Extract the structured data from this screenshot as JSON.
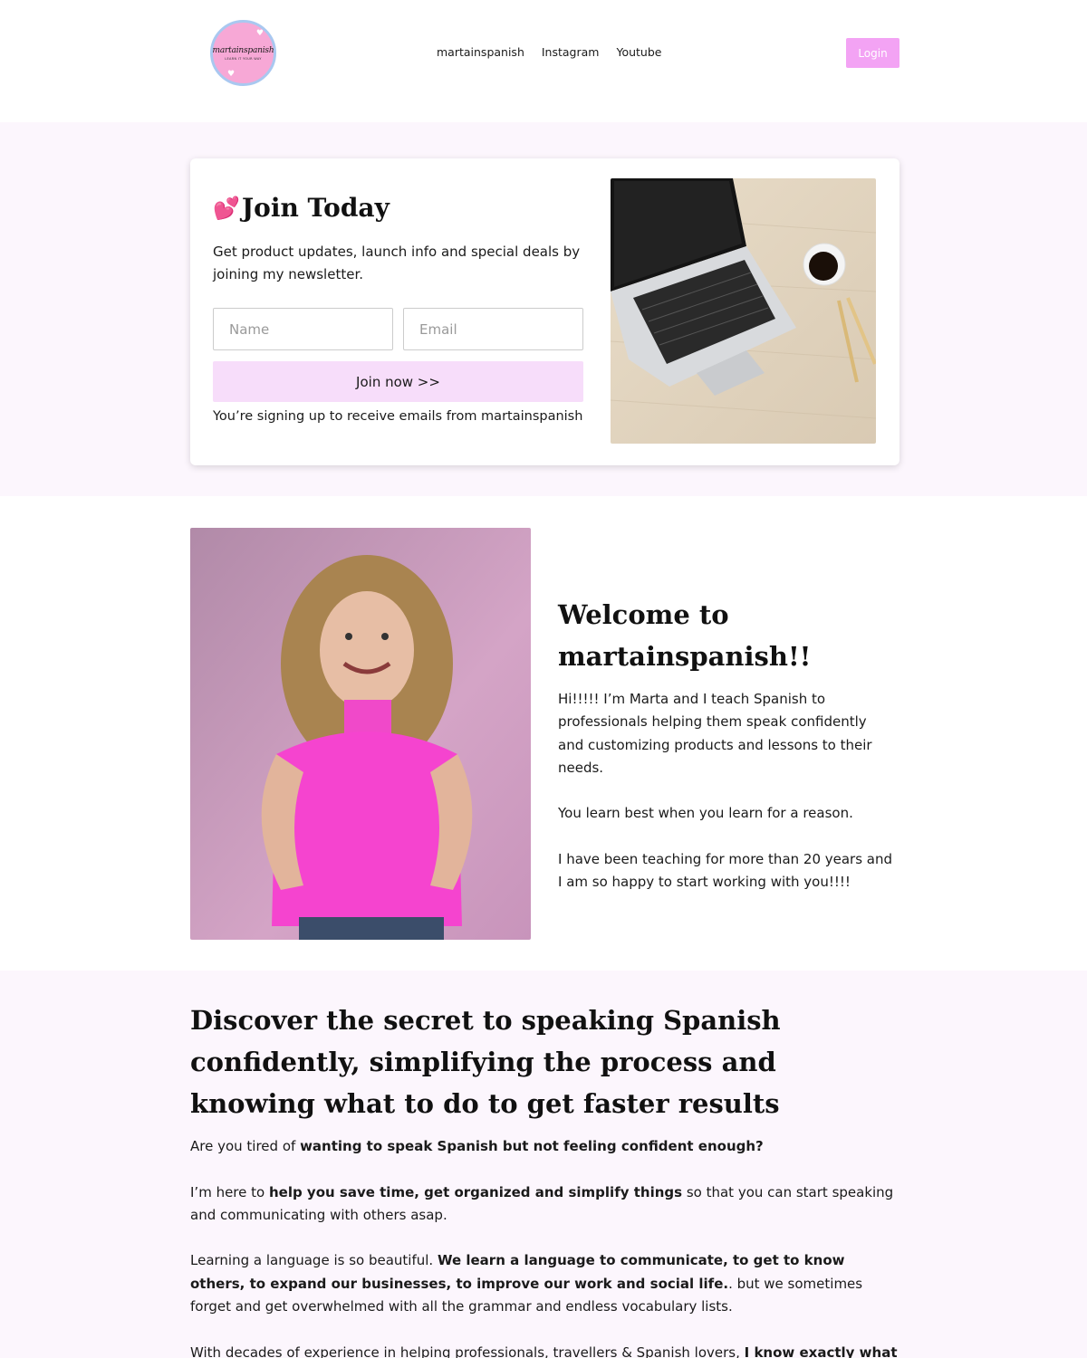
{
  "header": {
    "logo_text": "martainspanish",
    "logo_tagline": "LEARN IT YOUR WAY",
    "nav": [
      "martainspanish",
      "Instagram",
      "Youtube"
    ],
    "login_label": "Login"
  },
  "newsletter": {
    "emoji": "💕",
    "title": "Join Today",
    "description": " Get product updates, launch info and special deals by joining my newsletter.",
    "name_placeholder": "Name",
    "email_placeholder": "Email",
    "button_label": "Join now >>",
    "disclaimer": "You’re signing up to receive emails from martainspanish"
  },
  "welcome": {
    "title": "Welcome to martainspanish!!",
    "p1": "Hi!!!!!  I’m Marta and I teach Spanish to professionals helping them speak confidently and customizing products and lessons to their needs.",
    "p2": " You learn best when you learn for a reason.",
    "p3": "I have been teaching for more than 20 years and I am so happy to start working with you!!!!"
  },
  "discover": {
    "title": "Discover the secret to speaking Spanish confidently, simplifying the process and knowing what to do to get faster results",
    "p1_a": "Are you tired of ",
    "p1_b": "wanting to speak Spanish but not feeling confident enough?",
    "p2_a": "I’m here to ",
    "p2_b": "help you save time, get organized and simplify things",
    "p2_c": " so that you can start speaking and communicating with others asap.",
    "p3_a": "Learning a language is so beautiful. ",
    "p3_b": "We learn a language to communicate, to get to know others, to expand our businesses, to improve our work and social life.",
    "p3_c": ". but we sometimes forget and get overwhelmed with all the grammar and endless vocabulary lists.",
    "p4_a": "With decades of experience in helping professionals, travellers & Spanish lovers, ",
    "p4_b": "I know exactly what it’s"
  },
  "colors": {
    "accent": "#f3a3f4",
    "join_button": "#f7ddfa",
    "section_tint": "#fcf6fd",
    "heart": "#e63ea8"
  }
}
